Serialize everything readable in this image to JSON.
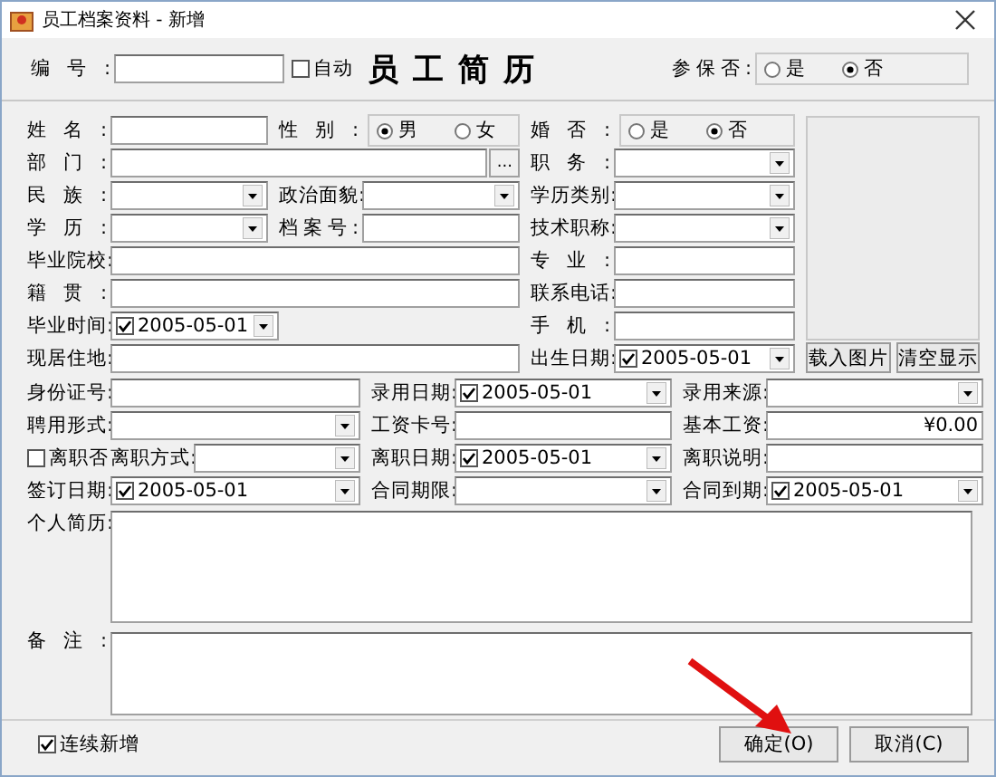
{
  "window": {
    "title": "员工档案资料 - 新增"
  },
  "header": {
    "number": {
      "label": "编号:"
    },
    "auto": {
      "label": "自动",
      "checked": false
    },
    "title": "员工简历",
    "insured": {
      "label": "参保否:",
      "options": [
        {
          "label": "是",
          "selected": false
        },
        {
          "label": "否",
          "selected": true
        }
      ]
    }
  },
  "main_rows": [
    {
      "left": [
        {
          "kind": "text",
          "label": "姓名:"
        },
        {
          "kind": "radio",
          "label": "性别:",
          "options": [
            {
              "label": "男",
              "selected": true
            },
            {
              "label": "女",
              "selected": false
            }
          ]
        }
      ],
      "right": {
        "kind": "radio",
        "label": "婚否:",
        "options": [
          {
            "label": "是",
            "selected": false
          },
          {
            "label": "否",
            "selected": true
          }
        ]
      }
    },
    {
      "left": [
        {
          "kind": "browse",
          "label": "部门:",
          "button": "..."
        }
      ],
      "right": {
        "kind": "combo",
        "label": "职务:"
      }
    },
    {
      "left": [
        {
          "kind": "combo",
          "label": "民族:"
        },
        {
          "kind": "combo",
          "label": "政治面貌:"
        }
      ],
      "right": {
        "kind": "combo",
        "label": "学历类别:"
      }
    },
    {
      "left": [
        {
          "kind": "combo",
          "label": "学历:"
        },
        {
          "kind": "text",
          "label": "档案号:"
        }
      ],
      "right": {
        "kind": "combo",
        "label": "技术职称:"
      }
    },
    {
      "left": [
        {
          "kind": "text",
          "label": "毕业院校:"
        }
      ],
      "right": {
        "kind": "text",
        "label": "专业:"
      }
    },
    {
      "left": [
        {
          "kind": "text",
          "label": "籍贯:"
        }
      ],
      "right": {
        "kind": "text",
        "label": "联系电话:"
      }
    },
    {
      "left": [
        {
          "kind": "date",
          "label": "毕业时间:",
          "checked": true,
          "value": "2005-05-01"
        }
      ],
      "right": {
        "kind": "text",
        "label": "手机:"
      }
    },
    {
      "left": [
        {
          "kind": "text",
          "label": "现居住地:"
        }
      ],
      "right": {
        "kind": "date",
        "label": "出生日期:",
        "checked": true,
        "value": "2005-05-01"
      }
    }
  ],
  "photo": {
    "buttons": [
      "载入图片",
      "清空显示"
    ]
  },
  "grid_rows": [
    [
      {
        "kind": "text",
        "label": "身份证号:"
      },
      {
        "kind": "date",
        "label": "录用日期:",
        "checked": true,
        "value": "2005-05-01"
      },
      {
        "kind": "combo",
        "label": "录用来源:"
      }
    ],
    [
      {
        "kind": "combo",
        "label": "聘用形式:"
      },
      {
        "kind": "text",
        "label": "工资卡号:"
      },
      {
        "kind": "number",
        "label": "基本工资:",
        "value": "¥0.00"
      }
    ],
    [
      {
        "kind": "combo",
        "label": "离职方式:",
        "toggle": {
          "label": "离职否",
          "checked": false
        }
      },
      {
        "kind": "date",
        "label": "离职日期:",
        "checked": true,
        "value": "2005-05-01"
      },
      {
        "kind": "text",
        "label": "离职说明:"
      }
    ],
    [
      {
        "kind": "date",
        "label": "签订日期:",
        "checked": true,
        "value": "2005-05-01"
      },
      {
        "kind": "combo",
        "label": "合同期限:"
      },
      {
        "kind": "date",
        "label": "合同到期:",
        "checked": true,
        "value": "2005-05-01"
      }
    ]
  ],
  "memos": [
    {
      "label": "个人简历:"
    },
    {
      "label": "备注:"
    }
  ],
  "footer": {
    "continuous": {
      "label": "连续新增",
      "checked": true
    },
    "buttons": [
      "确定(O)",
      "取消(C)"
    ]
  }
}
